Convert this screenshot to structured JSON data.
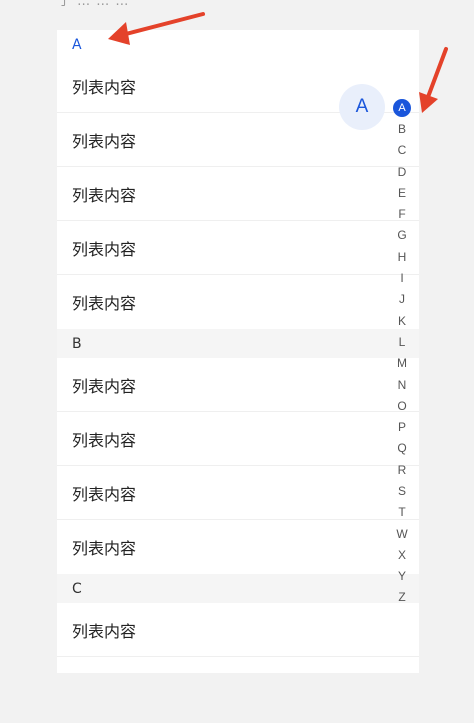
{
  "topText": "了  …    …  …   ",
  "sections": [
    {
      "key": "A",
      "items": [
        "列表内容",
        "列表内容",
        "列表内容",
        "列表内容",
        "列表内容"
      ]
    },
    {
      "key": "B",
      "items": [
        "列表内容",
        "列表内容",
        "列表内容",
        "列表内容"
      ]
    },
    {
      "key": "C",
      "items": [
        "列表内容"
      ]
    }
  ],
  "activeLetter": "A",
  "indexLetters": [
    "A",
    "B",
    "C",
    "D",
    "E",
    "F",
    "G",
    "H",
    "I",
    "J",
    "K",
    "L",
    "M",
    "N",
    "O",
    "P",
    "Q",
    "R",
    "S",
    "T",
    "W",
    "X",
    "Y",
    "Z"
  ],
  "colors": {
    "accent": "#1a56db",
    "arrow": "#e4422a"
  }
}
